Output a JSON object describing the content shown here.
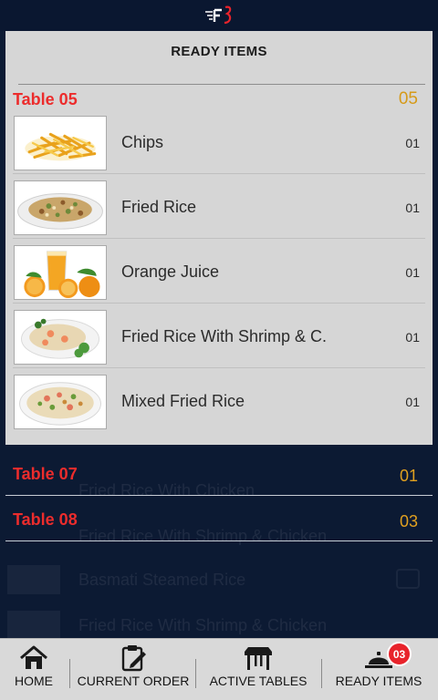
{
  "panel": {
    "title": "READY ITEMS"
  },
  "open_table": {
    "name": "Table 05",
    "count": "05",
    "items": [
      {
        "name": "Chips",
        "qty": "01",
        "image": "chips"
      },
      {
        "name": "Fried Rice",
        "qty": "01",
        "image": "fried-rice"
      },
      {
        "name": "Orange Juice",
        "qty": "01",
        "image": "orange-juice"
      },
      {
        "name": "Fried Rice With Shrimp & C.",
        "qty": "01",
        "image": "shrimp-rice"
      },
      {
        "name": "Mixed Fried Rice",
        "qty": "01",
        "image": "mixed-rice"
      }
    ]
  },
  "collapsed_tables": [
    {
      "name": "Table 07",
      "count": "01"
    },
    {
      "name": "Table 08",
      "count": "03"
    }
  ],
  "background_list": [
    "Fried Rice With Chicken",
    "Fried Rice With Shrimp & Chicken",
    "Basmati Steamed Rice",
    "Fried Rice With Shrimp & Chicken"
  ],
  "nav": {
    "home": "HOME",
    "current_order": "CURRENT ORDER",
    "active_tables": "ACTIVE TABLES",
    "ready_items": "READY ITEMS",
    "ready_badge": "03"
  },
  "colors": {
    "background": "#0c1a33",
    "panel": "#d6d6d6",
    "table_name": "#ec2c2c",
    "table_count": "#e0a020",
    "badge": "#e8232b"
  }
}
